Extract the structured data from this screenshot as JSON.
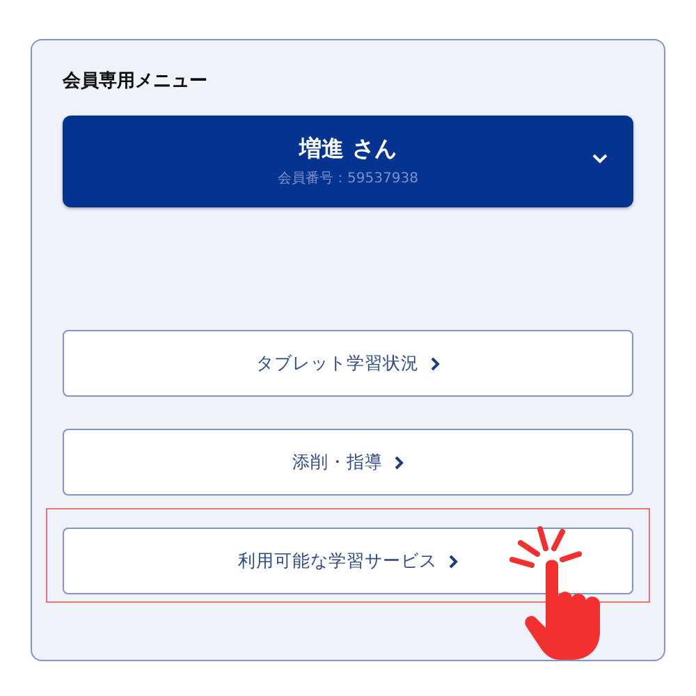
{
  "panel": {
    "title": "会員専用メニュー"
  },
  "member": {
    "name": "増進 さん",
    "number": "会員番号：59537938",
    "expanded": false
  },
  "menu_items": [
    {
      "label": "タブレット学習状況",
      "highlighted": false
    },
    {
      "label": "添削・指導",
      "highlighted": false
    },
    {
      "label": "利用可能な学習サービス",
      "highlighted": true
    }
  ]
}
